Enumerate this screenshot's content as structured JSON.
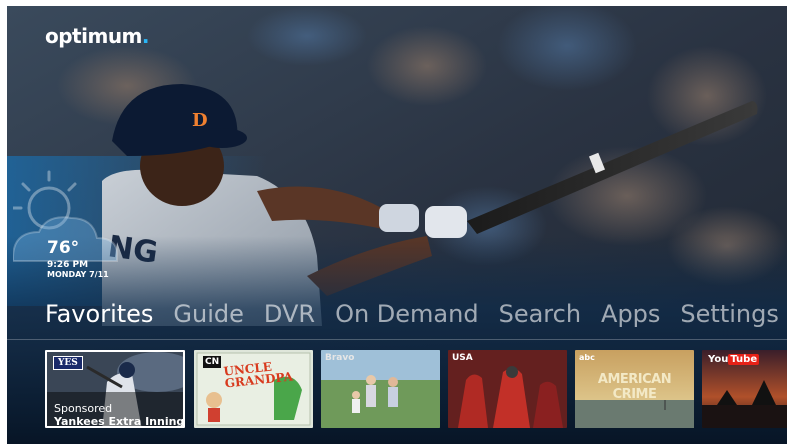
{
  "app": {
    "brand_name": "optimum",
    "brand_dot": ".",
    "accent_color": "#29b6f6"
  },
  "weather": {
    "icon": "partly-cloudy-icon",
    "temperature": "76°",
    "time": "9:26 PM",
    "date": "MONDAY 7/11"
  },
  "nav": {
    "items": [
      {
        "label": "Favorites",
        "active": true
      },
      {
        "label": "Guide",
        "active": false
      },
      {
        "label": "DVR",
        "active": false
      },
      {
        "label": "On Demand",
        "active": false
      },
      {
        "label": "Search",
        "active": false
      },
      {
        "label": "Apps",
        "active": false
      },
      {
        "label": "Settings",
        "active": false
      }
    ]
  },
  "tiles": [
    {
      "badge": "YES",
      "label": "Sponsored",
      "title": "Yankees Extra Innings",
      "selected": true
    },
    {
      "channel": "CN",
      "title_line1": "UNCLE",
      "title_line2": "GRANDPA"
    },
    {
      "channel": "Bravo"
    },
    {
      "channel": "USA"
    },
    {
      "channel": "abc",
      "title": "AMERICAN CRIME"
    },
    {
      "channel_part1": "You",
      "channel_part2": "Tube"
    }
  ]
}
